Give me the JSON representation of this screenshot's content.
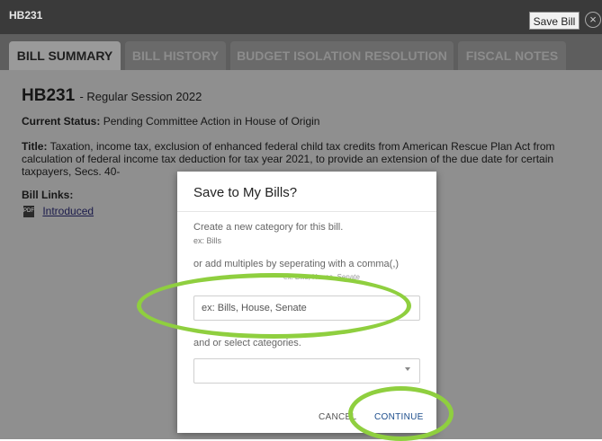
{
  "header": {
    "bill_id": "HB231",
    "save_bill_label": "Save Bill",
    "close_symbol": "×"
  },
  "tabs": [
    {
      "label": "BILL SUMMARY",
      "active": true
    },
    {
      "label": "BILL HISTORY",
      "active": false
    },
    {
      "label": "BUDGET ISOLATION RESOLUTION",
      "active": false
    },
    {
      "label": "FISCAL NOTES",
      "active": false
    }
  ],
  "summary": {
    "bill_number": "HB231",
    "session": "- Regular Session 2022",
    "status_label": "Current Status:",
    "status_value": "Pending Committee Action in House of Origin",
    "title_label": "Title:",
    "title_text": "Taxation, income tax, exclusion of enhanced federal child tax credits from American Rescue Plan Act from calculation of federal income tax deduction for tax year 2021, to provide an extension of the due date for certain taxpayers, Secs. 40-",
    "links_label": "Bill Links:",
    "pdf_icon_text": "PDF",
    "link_introduced": "Introduced"
  },
  "modal": {
    "title": "Save to My Bills?",
    "create_label": "Create a new category for this bill.",
    "create_hint": "ex: Bills",
    "multiples_label": "or add multiples by seperating with a comma(,)",
    "multiples_hint": "ex: Bills, House, Senate",
    "input_placeholder": "ex: Bills, House, Senate",
    "select_label": "and or select categories.",
    "selected_value": "",
    "cancel_label": "CANCEL",
    "continue_label": "CONTINUE"
  },
  "colors": {
    "highlight": "#8fcf3f",
    "continue_accent": "#1c4d8c"
  }
}
